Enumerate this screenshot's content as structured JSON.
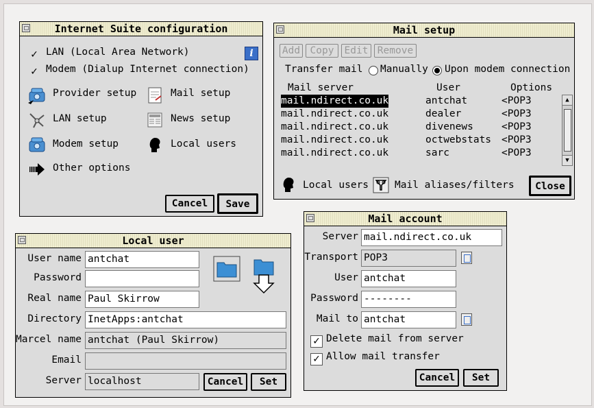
{
  "internet_suite": {
    "title": "Internet Suite configuration",
    "lan_label": "LAN (Local Area Network)",
    "modem_label": "Modem (Dialup Internet connection)",
    "info_glyph": "i",
    "items": {
      "provider": "Provider setup",
      "mail": "Mail setup",
      "lan": "LAN setup",
      "news": "News setup",
      "modem": "Modem setup",
      "local_users": "Local users",
      "other": "Other options"
    },
    "cancel": "Cancel",
    "save": "Save"
  },
  "mail_setup": {
    "title": "Mail setup",
    "toolbar": {
      "add": "Add",
      "copy": "Copy",
      "edit": "Edit",
      "remove": "Remove"
    },
    "transfer_label": "Transfer mail",
    "manually": "Manually",
    "upon_modem": "Upon modem connection",
    "columns": {
      "server": "Mail server",
      "user": "User",
      "options": "Options"
    },
    "rows": [
      {
        "server": "mail.ndirect.co.uk",
        "user": "antchat",
        "options": "<POP3"
      },
      {
        "server": "mail.ndirect.co.uk",
        "user": "dealer",
        "options": "<POP3"
      },
      {
        "server": "mail.ndirect.co.uk",
        "user": "divenews",
        "options": "<POP3"
      },
      {
        "server": "mail.ndirect.co.uk",
        "user": "octwebstats",
        "options": "<POP3"
      },
      {
        "server": "mail.ndirect.co.uk",
        "user": "sarc",
        "options": "<POP3"
      }
    ],
    "local_users": "Local users",
    "mail_aliases": "Mail aliases/filters",
    "close": "Close"
  },
  "local_user": {
    "title": "Local user",
    "labels": {
      "user_name": "User name",
      "password": "Password",
      "real_name": "Real name",
      "directory": "Directory",
      "marcel_name": "Marcel name",
      "email": "Email",
      "server": "Server"
    },
    "values": {
      "user_name": "antchat",
      "password": "",
      "real_name": "Paul Skirrow",
      "directory": "InetApps:antchat",
      "marcel_name": "antchat (Paul Skirrow)",
      "email": "",
      "server": "localhost"
    },
    "cancel": "Cancel",
    "set": "Set"
  },
  "mail_account": {
    "title": "Mail account",
    "labels": {
      "server": "Server",
      "transport": "Transport",
      "user": "User",
      "password": "Password",
      "mail_to": "Mail to"
    },
    "values": {
      "server": "mail.ndirect.co.uk",
      "transport": "POP3",
      "user": "antchat",
      "password": "--------",
      "mail_to": "antchat"
    },
    "delete_label": "Delete mail from server",
    "allow_label": "Allow mail transfer",
    "cancel": "Cancel",
    "set": "Set"
  }
}
